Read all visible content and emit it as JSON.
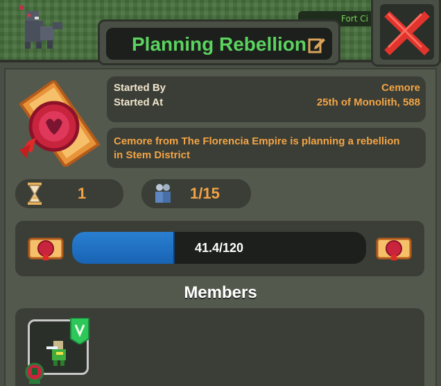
{
  "map": {
    "label": "Fort Ci"
  },
  "window": {
    "title": "Planning Rebellion"
  },
  "info": {
    "started_by_label": "Started By",
    "started_by_value": "Cemore",
    "started_at_label": "Started At",
    "started_at_value": "25th of Monolith, 588"
  },
  "description": "Cemore from The Florencia Empire is planning a rebellion in Stem District",
  "stats": {
    "time_value": "1",
    "members_value": "1/15"
  },
  "progress": {
    "current": 41.4,
    "max": 120,
    "text": "41.4/120"
  },
  "members": {
    "title": "Members"
  },
  "colors": {
    "title_green": "#5bd35f",
    "value_orange": "#f3a445",
    "progress_blue": "#1e6fc3",
    "close_red": "#e0342d"
  },
  "icons": {
    "edit": "edit-icon",
    "close": "close-x-icon",
    "seal": "wax-seal-scroll-icon",
    "hourglass": "hourglass-icon",
    "people": "people-icon",
    "leader": "leader-banner-icon",
    "kingdom": "kingdom-emblem-icon"
  }
}
